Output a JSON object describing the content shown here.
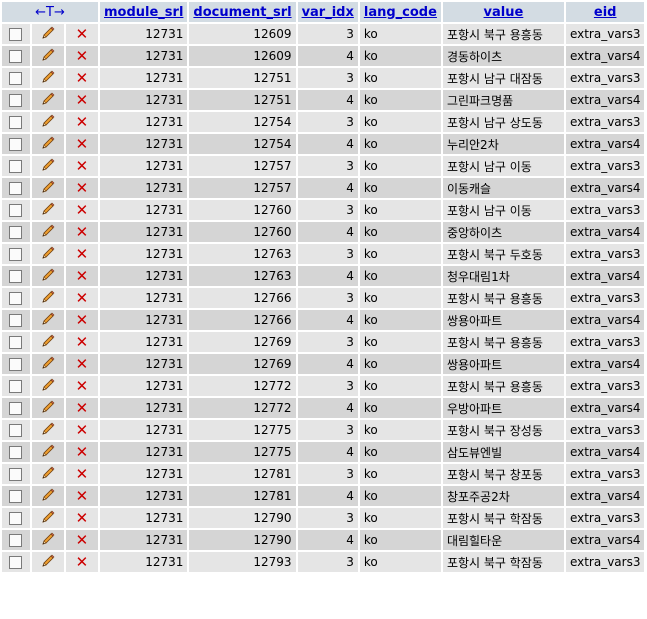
{
  "header": {
    "arrows_label": "←T→",
    "columns": [
      "module_srl",
      "document_srl",
      "var_idx",
      "lang_code",
      "value",
      "eid"
    ]
  },
  "rows": [
    {
      "module_srl": "12731",
      "document_srl": "12609",
      "var_idx": "3",
      "lang_code": "ko",
      "value": "포항시 북구 용흥동",
      "eid": "extra_vars3"
    },
    {
      "module_srl": "12731",
      "document_srl": "12609",
      "var_idx": "4",
      "lang_code": "ko",
      "value": "경동하이츠",
      "eid": "extra_vars4"
    },
    {
      "module_srl": "12731",
      "document_srl": "12751",
      "var_idx": "3",
      "lang_code": "ko",
      "value": "포항시 남구 대잠동",
      "eid": "extra_vars3"
    },
    {
      "module_srl": "12731",
      "document_srl": "12751",
      "var_idx": "4",
      "lang_code": "ko",
      "value": "그린파크명품",
      "eid": "extra_vars4"
    },
    {
      "module_srl": "12731",
      "document_srl": "12754",
      "var_idx": "3",
      "lang_code": "ko",
      "value": "포항시 남구 상도동",
      "eid": "extra_vars3"
    },
    {
      "module_srl": "12731",
      "document_srl": "12754",
      "var_idx": "4",
      "lang_code": "ko",
      "value": "누리안2차",
      "eid": "extra_vars4"
    },
    {
      "module_srl": "12731",
      "document_srl": "12757",
      "var_idx": "3",
      "lang_code": "ko",
      "value": "포항시 남구 이동",
      "eid": "extra_vars3"
    },
    {
      "module_srl": "12731",
      "document_srl": "12757",
      "var_idx": "4",
      "lang_code": "ko",
      "value": "이동캐슬",
      "eid": "extra_vars4"
    },
    {
      "module_srl": "12731",
      "document_srl": "12760",
      "var_idx": "3",
      "lang_code": "ko",
      "value": "포항시 남구 이동",
      "eid": "extra_vars3"
    },
    {
      "module_srl": "12731",
      "document_srl": "12760",
      "var_idx": "4",
      "lang_code": "ko",
      "value": "중앙하이츠",
      "eid": "extra_vars4"
    },
    {
      "module_srl": "12731",
      "document_srl": "12763",
      "var_idx": "3",
      "lang_code": "ko",
      "value": "포항시 북구 두호동",
      "eid": "extra_vars3"
    },
    {
      "module_srl": "12731",
      "document_srl": "12763",
      "var_idx": "4",
      "lang_code": "ko",
      "value": "청우대림1차",
      "eid": "extra_vars4"
    },
    {
      "module_srl": "12731",
      "document_srl": "12766",
      "var_idx": "3",
      "lang_code": "ko",
      "value": "포항시 북구 용흥동",
      "eid": "extra_vars3"
    },
    {
      "module_srl": "12731",
      "document_srl": "12766",
      "var_idx": "4",
      "lang_code": "ko",
      "value": "쌍용아파트",
      "eid": "extra_vars4"
    },
    {
      "module_srl": "12731",
      "document_srl": "12769",
      "var_idx": "3",
      "lang_code": "ko",
      "value": "포항시 북구 용흥동",
      "eid": "extra_vars3"
    },
    {
      "module_srl": "12731",
      "document_srl": "12769",
      "var_idx": "4",
      "lang_code": "ko",
      "value": "쌍용아파트",
      "eid": "extra_vars4"
    },
    {
      "module_srl": "12731",
      "document_srl": "12772",
      "var_idx": "3",
      "lang_code": "ko",
      "value": "포항시 북구 용흥동",
      "eid": "extra_vars3"
    },
    {
      "module_srl": "12731",
      "document_srl": "12772",
      "var_idx": "4",
      "lang_code": "ko",
      "value": "우방아파트",
      "eid": "extra_vars4"
    },
    {
      "module_srl": "12731",
      "document_srl": "12775",
      "var_idx": "3",
      "lang_code": "ko",
      "value": "포항시 북구 장성동",
      "eid": "extra_vars3"
    },
    {
      "module_srl": "12731",
      "document_srl": "12775",
      "var_idx": "4",
      "lang_code": "ko",
      "value": "삼도뷰엔빌",
      "eid": "extra_vars4"
    },
    {
      "module_srl": "12731",
      "document_srl": "12781",
      "var_idx": "3",
      "lang_code": "ko",
      "value": "포항시 북구 창포동",
      "eid": "extra_vars3"
    },
    {
      "module_srl": "12731",
      "document_srl": "12781",
      "var_idx": "4",
      "lang_code": "ko",
      "value": "창포주공2차",
      "eid": "extra_vars4"
    },
    {
      "module_srl": "12731",
      "document_srl": "12790",
      "var_idx": "3",
      "lang_code": "ko",
      "value": "포항시 북구 학잠동",
      "eid": "extra_vars3"
    },
    {
      "module_srl": "12731",
      "document_srl": "12790",
      "var_idx": "4",
      "lang_code": "ko",
      "value": "대림힐타운",
      "eid": "extra_vars4"
    },
    {
      "module_srl": "12731",
      "document_srl": "12793",
      "var_idx": "3",
      "lang_code": "ko",
      "value": "포항시 북구 학잠동",
      "eid": "extra_vars3"
    }
  ],
  "icons": {
    "checkbox": "checkbox-icon",
    "edit": "pencil-icon",
    "delete": "delete-x-icon"
  },
  "colors": {
    "header_bg": "#d3dce3",
    "header_text": "#0000cc",
    "row_odd": "#e5e5e5",
    "row_even": "#d5d5d5",
    "delete": "#cc0000"
  }
}
